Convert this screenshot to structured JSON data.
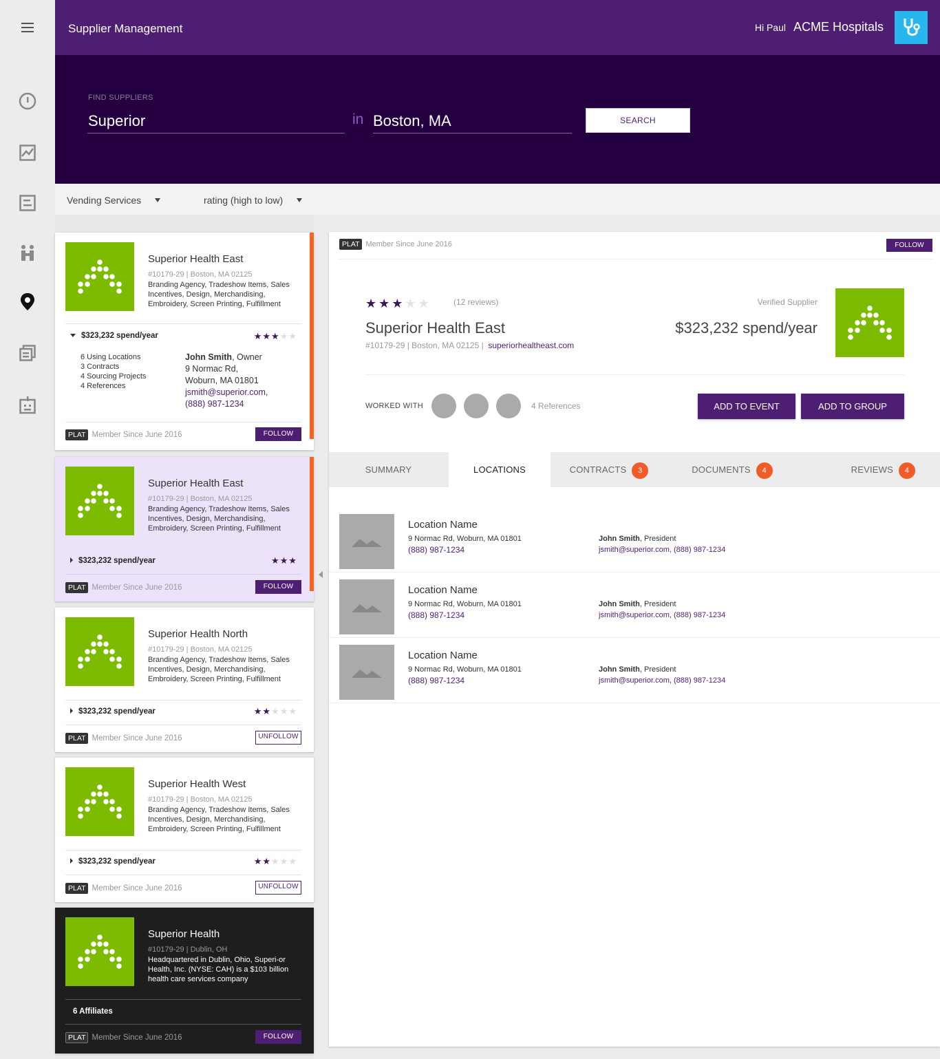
{
  "app": {
    "title": "Supplier Management",
    "greeting": "Hi Paul",
    "org": "ACME Hospitals"
  },
  "nav": {
    "icons": [
      "menu-icon",
      "dashboard-icon",
      "chart-icon",
      "list-icon",
      "people-icon",
      "location-pin-icon",
      "documents-icon",
      "calendar-icon"
    ]
  },
  "search": {
    "label": "FIND SUPPLIERS",
    "query": "Superior",
    "in": "in",
    "location": "Boston, MA",
    "button": "SEARCH"
  },
  "filters": {
    "category": "Vending Services",
    "sort": "rating (high to low)"
  },
  "cards": [
    {
      "name": "Superior Health East",
      "meta": "#10179-29  |  Boston, MA 02125",
      "desc": "Branding Agency, Tradeshow Items, Sales Incentives, Design, Merchandising, Embroidery, Screen Printing, Fulfillment",
      "spend": "$323,232 spend/year",
      "rating": 3,
      "tier": "PLAT",
      "since": "Member Since June 2016",
      "action": "FOLLOW",
      "stats": [
        "6 Using Locations",
        "3 Contracts",
        "4 Sourcing Projects",
        "4 References"
      ],
      "contact": {
        "name": "John Smith",
        "role": ", Owner",
        "addr1": "9 Normac Rd,",
        "addr2": "Woburn, MA 01801",
        "email": "jsmith@superior.com,",
        "phone": "(888) 987-1234"
      }
    },
    {
      "name": "Superior Health East",
      "meta": "#10179-29  |  Boston, MA 02125",
      "desc": "Branding Agency, Tradeshow Items, Sales Incentives, Design, Merchandising, Embroidery, Screen Printing, Fulfillment",
      "spend": "$323,232 spend/year",
      "rating": 3,
      "tier": "PLAT",
      "since": "Member Since June 2016",
      "action": "FOLLOW"
    },
    {
      "name": "Superior Health North",
      "meta": "#10179-29  |  Boston, MA 02125",
      "desc": "Branding Agency, Tradeshow Items, Sales Incentives, Design, Merchandising, Embroidery, Screen Printing, Fulfillment",
      "spend": "$323,232 spend/year",
      "rating": 2,
      "tier": "PLAT",
      "since": "Member Since June 2016",
      "action": "UNFOLLOW"
    },
    {
      "name": "Superior Health West",
      "meta": "#10179-29  |  Boston, MA 02125",
      "desc": "Branding Agency, Tradeshow Items, Sales Incentives, Design, Merchandising, Embroidery, Screen Printing, Fulfillment",
      "spend": "$323,232 spend/year",
      "rating": 2,
      "tier": "PLAT",
      "since": "Member Since June 2016",
      "action": "UNFOLLOW"
    },
    {
      "name": "Superior Health",
      "meta": "#10179-29  |  Dublin, OH",
      "desc": "Headquartered in Dublin, Ohio, Superi-or Health, Inc. (NYSE: CAH) is a $103 billion health care services company",
      "affiliates": "6 Affiliates",
      "tier": "PLAT",
      "since": "Member Since June 2016",
      "action": "FOLLOW"
    }
  ],
  "detail": {
    "tier": "PLAT",
    "since": "Member Since  June 2016",
    "follow": "FOLLOW",
    "rating": 3,
    "reviews": "(12 reviews)",
    "verified": "Verified Supplier",
    "name": "Superior Health East",
    "meta": "#10179-29  |  Boston, MA 02125  |",
    "website": "superiorhealtheast.com",
    "spend": "$323,232 spend/year",
    "worked_with": "WORKED WITH",
    "references": "4 References",
    "add_event": "ADD TO EVENT",
    "add_group": "ADD TO GROUP",
    "tabs": [
      {
        "label": "SUMMARY",
        "count": ""
      },
      {
        "label": "LOCATIONS",
        "count": ""
      },
      {
        "label": "CONTRACTS",
        "count": "3"
      },
      {
        "label": "DOCUMENTS",
        "count": "4"
      },
      {
        "label": "REVIEWS",
        "count": "4"
      }
    ],
    "locations": [
      {
        "name": "Location Name",
        "addr": "9 Normac Rd, Woburn, MA 01801",
        "phone": "(888) 987-1234",
        "contact_name": "John Smith",
        "contact_role": ", President",
        "contact_line": "jsmith@superior.com, (888) 987-1234"
      },
      {
        "name": "Location Name",
        "addr": "9 Normac Rd, Woburn, MA 01801",
        "phone": "(888) 987-1234",
        "contact_name": "John Smith",
        "contact_role": ", President",
        "contact_line": "jsmith@superior.com, (888) 987-1234"
      },
      {
        "name": "Location Name",
        "addr": "9 Normac Rd, Woburn, MA 01801",
        "phone": "(888) 987-1234",
        "contact_name": "John Smith",
        "contact_role": ", President",
        "contact_line": "jsmith@superior.com, (888) 987-1234"
      }
    ]
  },
  "colors": {
    "brand": "#4e1e73",
    "hero": "#250040",
    "accent": "#f26522",
    "logo": "#7cbb00",
    "badge": "#27b7ee"
  }
}
